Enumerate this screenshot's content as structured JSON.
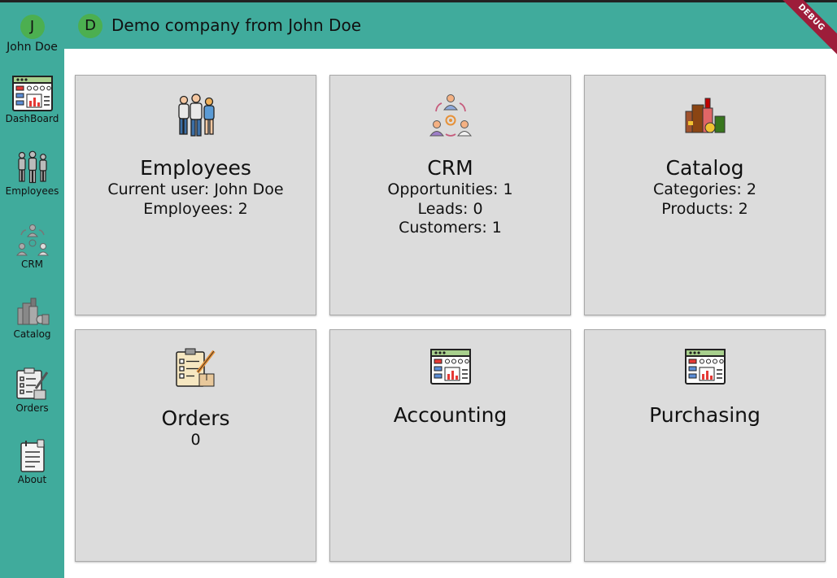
{
  "user": {
    "initial": "J",
    "name": "John Doe"
  },
  "appbar": {
    "initial": "D",
    "title": "Demo company from John Doe",
    "debug_label": "DEBUG"
  },
  "rail": {
    "items": [
      {
        "label": "DashBoard",
        "icon": "dashboard-icon"
      },
      {
        "label": "Employees",
        "icon": "employees-icon"
      },
      {
        "label": "CRM",
        "icon": "crm-icon"
      },
      {
        "label": "Catalog",
        "icon": "catalog-icon"
      },
      {
        "label": "Orders",
        "icon": "orders-icon"
      },
      {
        "label": "About",
        "icon": "about-icon"
      }
    ]
  },
  "cards": [
    {
      "title": "Employees",
      "icon": "employees-icon",
      "lines": [
        "Current user: John Doe",
        "Employees: 2"
      ]
    },
    {
      "title": "CRM",
      "icon": "crm-icon",
      "lines": [
        "Opportunities: 1",
        "Leads: 0",
        "Customers: 1"
      ]
    },
    {
      "title": "Catalog",
      "icon": "catalog-icon",
      "lines": [
        "Categories: 2",
        "Products: 2"
      ]
    },
    {
      "title": "Orders",
      "icon": "orders-icon",
      "lines": [
        "0"
      ]
    },
    {
      "title": "Accounting",
      "icon": "accounting-icon",
      "lines": []
    },
    {
      "title": "Purchasing",
      "icon": "purchasing-icon",
      "lines": []
    }
  ],
  "colors": {
    "accent": "#40ab9c",
    "avatar": "#4caf50",
    "card_bg": "#dcdcdc",
    "debug_banner": "#9d1d3a"
  }
}
